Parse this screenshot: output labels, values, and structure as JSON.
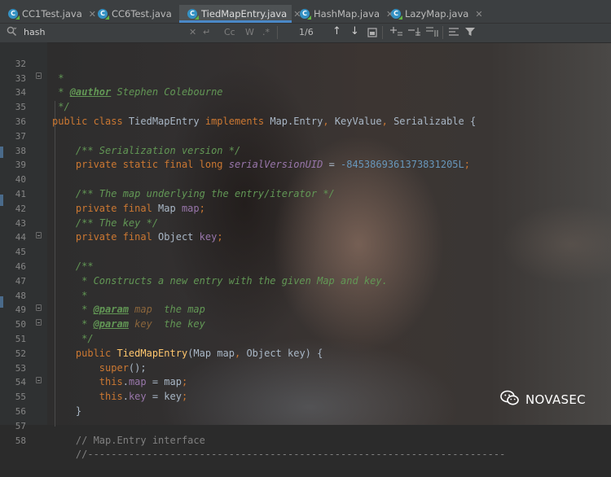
{
  "tabs": [
    {
      "label": "CC1Test.java",
      "active": false
    },
    {
      "label": "CC6Test.java",
      "active": false
    },
    {
      "label": "TiedMapEntry.java",
      "active": true
    },
    {
      "label": "HashMap.java",
      "active": false
    },
    {
      "label": "LazyMap.java",
      "active": false
    }
  ],
  "search": {
    "query": "hash",
    "match_case_label": "Cc",
    "words_label": "W",
    "regex_label": ".*",
    "match_count": "1/6"
  },
  "watermark": {
    "text": "NOVASEC"
  },
  "colors": {
    "keyword": "#cc7832",
    "comment": "#629755",
    "field": "#9876aa",
    "number": "#6897bb",
    "method": "#ffc66d",
    "text": "#a9b7c6",
    "active_tab_underline": "#4a88c7"
  },
  "code": {
    "l32": {
      "n": "32",
      "a": " *"
    },
    "l33": {
      "n": "33",
      "a": " * ",
      "b": "@author",
      "c": " Stephen Colebourne"
    },
    "l34": {
      "n": "34",
      "a": " */"
    },
    "l35": {
      "n": "35",
      "a": "public class ",
      "b": "TiedMapEntry ",
      "c": "implements ",
      "d": "Map.Entry",
      "e": ", ",
      "f": "KeyValue",
      "g": ", ",
      "h": "Serializable {"
    },
    "l36": {
      "n": "36"
    },
    "l37": {
      "n": "37",
      "a": "    /** Serialization version */"
    },
    "l38": {
      "n": "38",
      "a": "    private static final long ",
      "b": "serialVersionUID",
      "c": " = ",
      "d": "-8453869361373831205L",
      "e": ";"
    },
    "l39": {
      "n": "39"
    },
    "l40": {
      "n": "40",
      "a": "    /** The map underlying the entry/iterator */"
    },
    "l41": {
      "n": "41",
      "a": "    private final ",
      "b": "Map ",
      "c": "map",
      "d": ";"
    },
    "l42": {
      "n": "42",
      "a": "    /** The key */"
    },
    "l43": {
      "n": "43",
      "a": "    private final ",
      "b": "Object ",
      "c": "key",
      "d": ";"
    },
    "l44": {
      "n": "44"
    },
    "l45": {
      "n": "45",
      "a": "    /**"
    },
    "l46": {
      "n": "46",
      "a": "     * Constructs a new entry with the given Map and key."
    },
    "l47": {
      "n": "47",
      "a": "     *"
    },
    "l48": {
      "n": "48",
      "a": "     * ",
      "b": "@param",
      "c": " map",
      "d": "  the map"
    },
    "l49": {
      "n": "49",
      "a": "     * ",
      "b": "@param",
      "c": " key",
      "d": "  the key"
    },
    "l50": {
      "n": "50",
      "a": "     */"
    },
    "l51": {
      "n": "51",
      "a": "    public ",
      "b": "TiedMapEntry",
      "c": "(Map map",
      "d": ", ",
      "e": "Object key) {"
    },
    "l52": {
      "n": "52",
      "a": "        super",
      "b": "();"
    },
    "l53": {
      "n": "53",
      "a": "        this",
      "b": ".",
      "c": "map",
      "d": " = map",
      "e": ";"
    },
    "l54": {
      "n": "54",
      "a": "        this",
      "b": ".",
      "c": "key",
      "d": " = key",
      "e": ";"
    },
    "l55": {
      "n": "55",
      "a": "    }"
    },
    "l56": {
      "n": "56"
    },
    "l57": {
      "n": "57",
      "a": "    // Map.Entry interface"
    },
    "l58": {
      "n": "58",
      "a": "    //-----------------------------------------------------------------------"
    }
  }
}
